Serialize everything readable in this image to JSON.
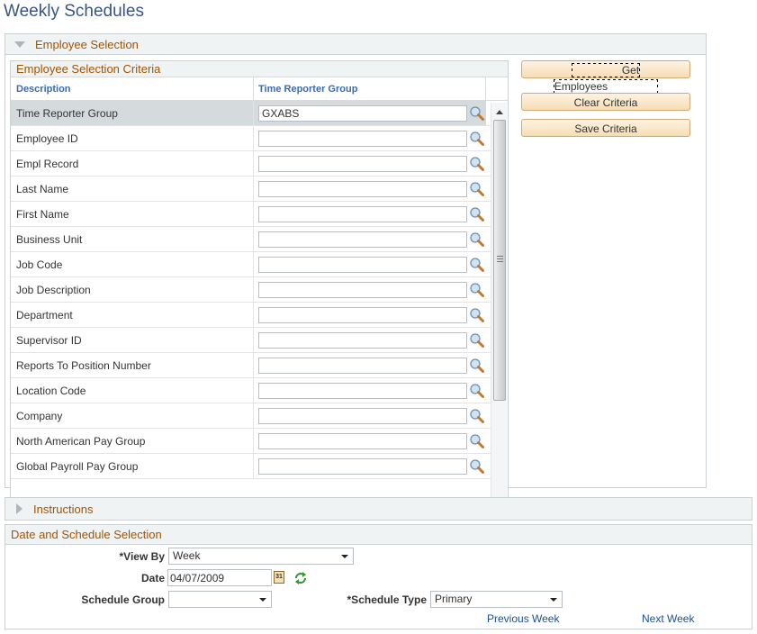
{
  "page": {
    "title": "Weekly Schedules"
  },
  "employee_selection": {
    "header": "Employee Selection",
    "grid": {
      "title": "Employee Selection Criteria",
      "columns": [
        "Description",
        "Time Reporter Group"
      ],
      "rows": [
        {
          "label": "Time Reporter Group",
          "value": "GXABS",
          "selected": true
        },
        {
          "label": "Employee ID",
          "value": ""
        },
        {
          "label": "Empl Record",
          "value": ""
        },
        {
          "label": "Last Name",
          "value": ""
        },
        {
          "label": "First Name",
          "value": ""
        },
        {
          "label": "Business Unit",
          "value": ""
        },
        {
          "label": "Job Code",
          "value": ""
        },
        {
          "label": "Job Description",
          "value": ""
        },
        {
          "label": "Department",
          "value": ""
        },
        {
          "label": "Supervisor ID",
          "value": ""
        },
        {
          "label": "Reports To Position Number",
          "value": ""
        },
        {
          "label": "Location Code",
          "value": ""
        },
        {
          "label": "Company",
          "value": ""
        },
        {
          "label": "North American Pay Group",
          "value": ""
        },
        {
          "label": "Global Payroll Pay Group",
          "value": ""
        }
      ]
    },
    "buttons": {
      "get_employees": "Get Employees",
      "clear_criteria": "Clear Criteria",
      "save_criteria": "Save Criteria"
    }
  },
  "instructions": {
    "header": "Instructions"
  },
  "date_schedule": {
    "header": "Date and Schedule Selection",
    "view_by": {
      "label": "*View By",
      "value": "Week"
    },
    "date": {
      "label": "Date",
      "value": "04/07/2009"
    },
    "schedule_group": {
      "label": "Schedule Group",
      "value": ""
    },
    "schedule_type": {
      "label": "*Schedule Type",
      "value": "Primary"
    },
    "previous_week": "Previous Week",
    "next_week": "Next Week"
  },
  "icons": {
    "lookup": "magnifier-lookup-icon",
    "calendar": "calendar-icon",
    "refresh": "refresh-icon"
  },
  "colors": {
    "section_header_text": "#a35300",
    "title_text": "#395584",
    "link": "#1c4f9c",
    "column_header": "#3a6bb0",
    "button_fill": "#f6ddb3",
    "selected_row": "#d5dbdc"
  }
}
